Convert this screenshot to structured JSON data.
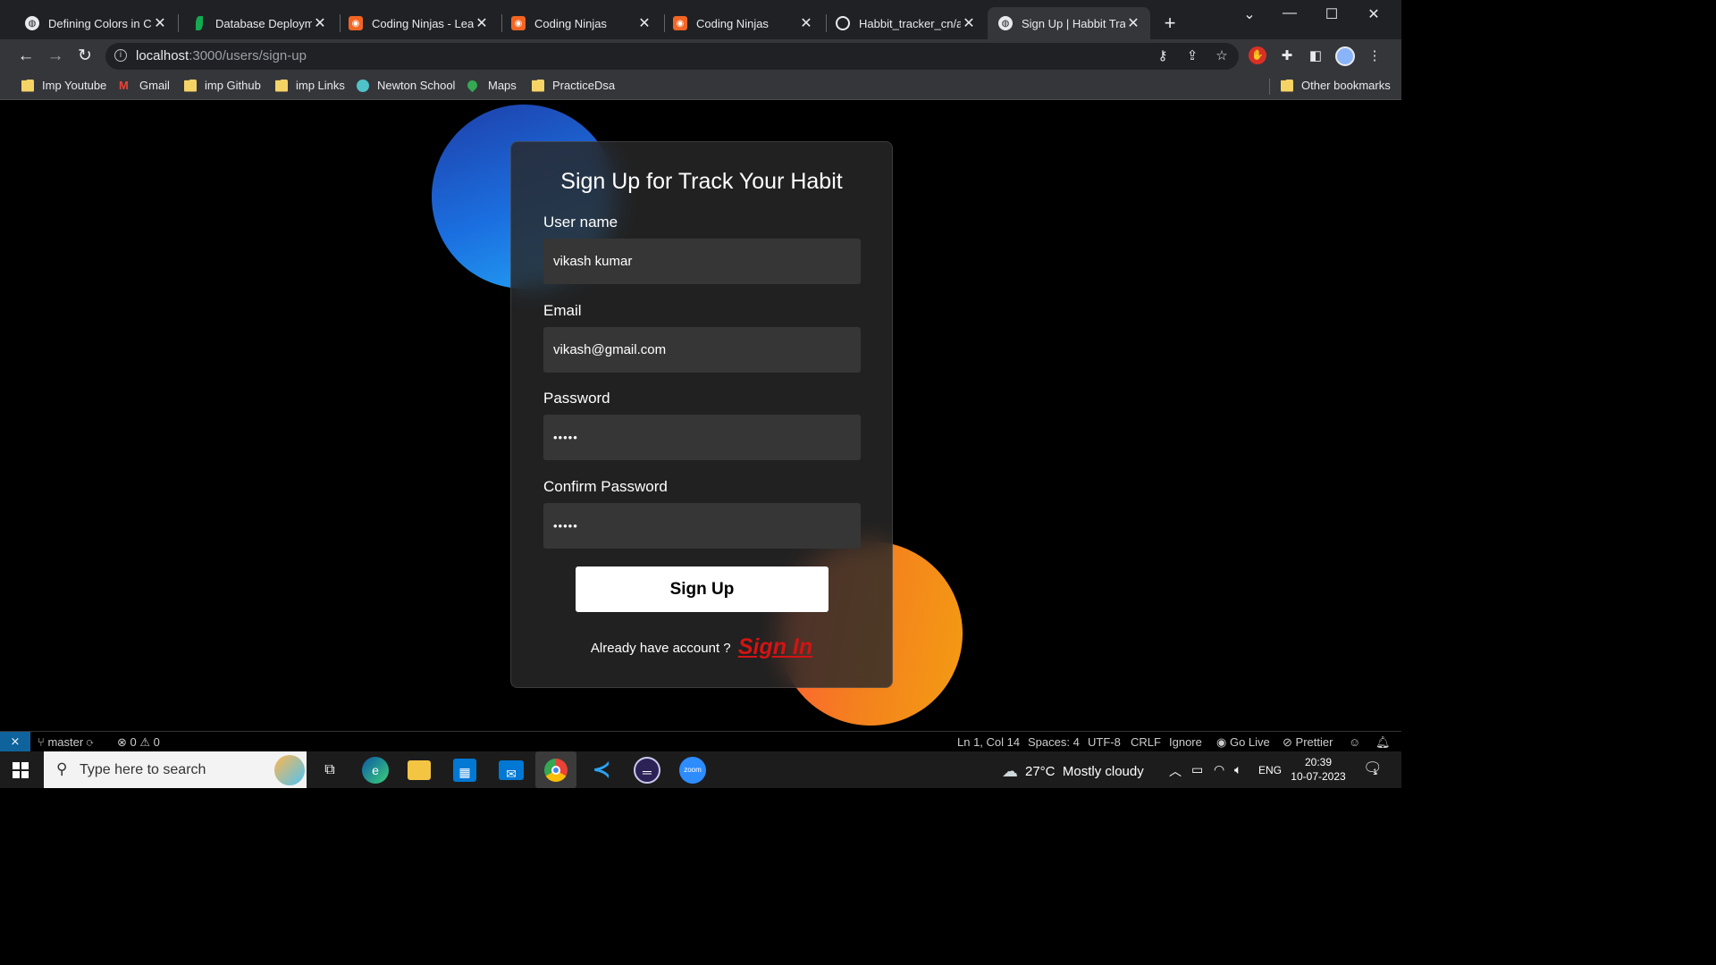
{
  "browser": {
    "tabs": [
      {
        "title": "Defining Colors in CS",
        "favicon": "globe-icon"
      },
      {
        "title": "Database Deploymen",
        "favicon": "mongodb-leaf-icon"
      },
      {
        "title": "Coding Ninjas - Learn",
        "favicon": "coding-ninjas-icon"
      },
      {
        "title": "Coding Ninjas",
        "favicon": "coding-ninjas-icon"
      },
      {
        "title": "Coding Ninjas",
        "favicon": "coding-ninjas-icon"
      },
      {
        "title": "Habbit_tracker_cn/as",
        "favicon": "github-icon"
      },
      {
        "title": "Sign Up | Habbit Trac",
        "favicon": "globe-icon"
      }
    ],
    "url_host": "localhost",
    "url_path": ":3000/users/sign-up",
    "bookmarks": [
      "Imp Youtube",
      "Gmail",
      "imp Github",
      "imp Links",
      "Newton School",
      "Maps",
      "PracticeDsa"
    ],
    "other_bookmarks": "Other bookmarks"
  },
  "page": {
    "title": "Sign Up for Track Your Habit",
    "username_label": "User name",
    "username_value": "vikash kumar",
    "email_label": "Email",
    "email_value": "vikash@gmail.com",
    "password_label": "Password",
    "password_value": "•••••",
    "confirm_label": "Confirm Password",
    "confirm_value": "•••••",
    "submit_label": "Sign Up",
    "already_text": "Already have account ?",
    "signin_link": "Sign In",
    "colors": {
      "blob_blue": "#1b6fe0",
      "blob_orange": "#f4811e",
      "signin": "#d21414"
    }
  },
  "statusbar": {
    "branch": "master",
    "errors": "0",
    "warnings": "0",
    "position": "Ln 1, Col 14",
    "spaces": "Spaces: 4",
    "encoding": "UTF-8",
    "eol": "CRLF",
    "ignore": "Ignore",
    "golive": "Go Live",
    "prettier": "Prettier"
  },
  "taskbar": {
    "search_placeholder": "Type here to search",
    "weather": "27°C  Mostly cloudy",
    "lang": "ENG",
    "time": "20:39",
    "date": "10-07-2023",
    "notif_count": "1"
  }
}
